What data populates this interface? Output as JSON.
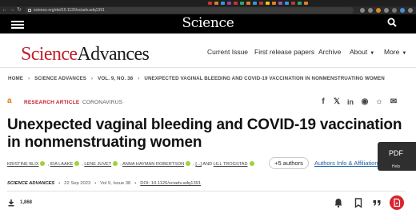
{
  "browser": {
    "url": "science.org/doi/10.1126/sciadv.adq1391"
  },
  "header": {
    "brand": "Science"
  },
  "site": {
    "logo_part1": "Science",
    "logo_part2": "Advances",
    "nav": [
      "Current Issue",
      "First release papers",
      "Archive",
      "About",
      "More"
    ]
  },
  "breadcrumb": [
    "HOME",
    "SCIENCE ADVANCES",
    "VOL. 9, NO. 38",
    "UNEXPECTED VAGINAL BLEEDING AND COVID-19 VACCINATION IN NONMENSTRUATING WOMEN"
  ],
  "article": {
    "type": "RESEARCH ARTICLE",
    "subject": "CORONAVIRUS",
    "title": "Unexpected vaginal bleeding and COVID-19 vaccination in nonmenstruating women",
    "authors": [
      "KRISTINE BLIX",
      "IDA LAAKE",
      "LENE JUVET",
      "ANNA HAYMAN ROBERTSON"
    ],
    "authors_ellipsis": "[...]",
    "authors_and": "AND",
    "last_author": "LILL TROGSTAD",
    "more_authors_label": "+5 authors",
    "affiliations_label": "Authors Info & Affiliations"
  },
  "pdf_widget": {
    "label": "PDF",
    "help": "Help"
  },
  "citation": {
    "journal": "SCIENCE ADVANCES",
    "date": "22 Sep 2023",
    "volume": "Vol 9, Issue 38",
    "doi": "DOI: 10.1126/sciadv.adq1391"
  },
  "metrics": {
    "downloads": "1,868"
  },
  "colors": {
    "brand_red": "#c0202c",
    "link_blue": "#1c5ea8",
    "orcid_green": "#a6ce39",
    "open_access_orange": "#e8760a"
  }
}
